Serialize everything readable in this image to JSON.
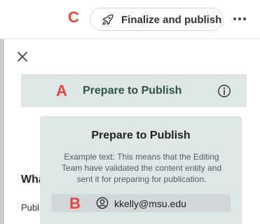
{
  "topbar": {
    "marker": "C",
    "publish_label": "Finalize and publish",
    "publish_icon": "rocket-icon",
    "more_icon": "more-horizontal-icon"
  },
  "panel": {
    "close_icon": "close-icon",
    "prepare_bar": {
      "marker": "A",
      "title": "Prepare to Publish",
      "info_icon": "info-icon"
    },
    "heading_fragment": "Wha",
    "text_fragment": "Publ"
  },
  "tooltip": {
    "title": "Prepare to Publish",
    "body": "Example text: This means that the Editing Team have validated the content entity and sent it for preparing for publication.",
    "user": {
      "marker": "B",
      "icon": "user-circle-icon",
      "email": "kkelly@msu.edu"
    }
  },
  "colors": {
    "marker": "#e8453c",
    "accent_green": "#2d5447",
    "bar_background": "#dfe6e6"
  }
}
